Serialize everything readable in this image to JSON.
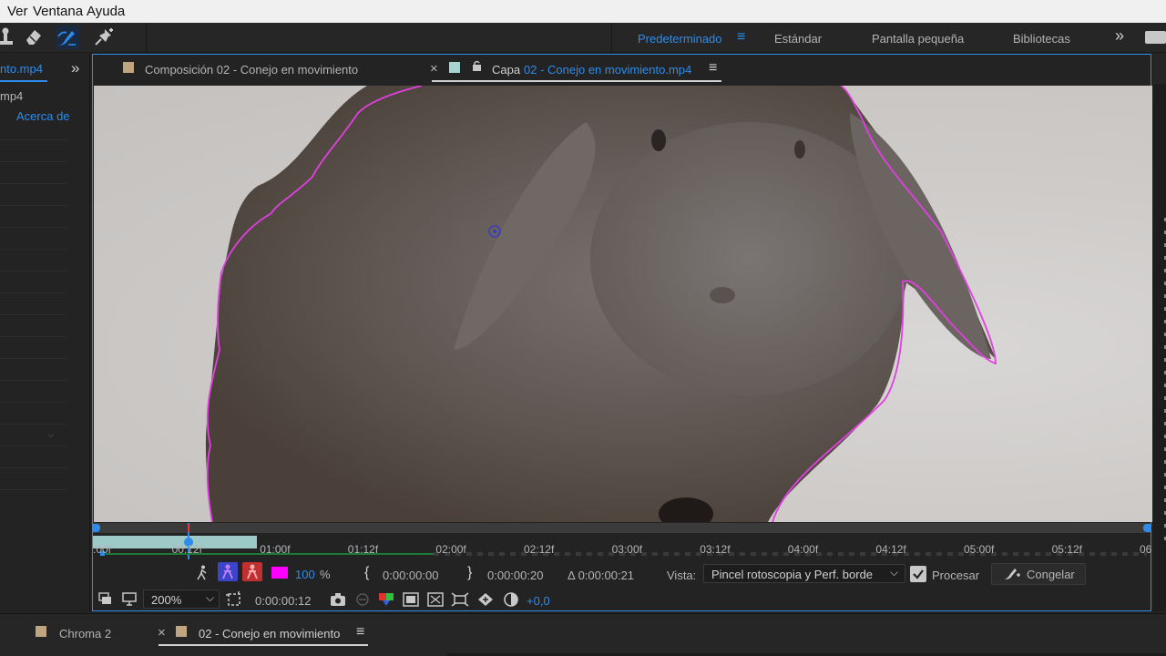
{
  "menubar": {
    "items": [
      "Ver",
      "Ventana",
      "Ayuda"
    ]
  },
  "toolbar": {
    "tools": [
      "stamp-icon",
      "eraser-icon",
      "roto-brush-icon",
      "pin-icon"
    ],
    "workspaces": [
      "Predeterminado",
      "Estándar",
      "Pantalla pequeña",
      "Bibliotecas"
    ],
    "active_workspace": "Predeterminado",
    "more_glyph": "»"
  },
  "left_panel": {
    "title": "nto.mp4",
    "subtitle": "mp4",
    "link": "Acerca de",
    "more_glyph": "»"
  },
  "viewer": {
    "tab_comp": "Composición 02 - Conejo en movimiento",
    "tab_layer_prefix": "Capa",
    "tab_layer_name": "02 - Conejo en movimiento.mp4",
    "close_glyph": "×",
    "menu_glyph": "≡"
  },
  "timeline": {
    "labels": [
      ":00f",
      "00:12f",
      "01:00f",
      "01:12f",
      "02:00f",
      "02:12f",
      "03:00f",
      "03:12f",
      "04:00f",
      "04:12f",
      "05:00f",
      "05:12f",
      "06"
    ],
    "work_area_fraction": [
      0.0,
      0.155
    ],
    "playhead_fraction": 0.09
  },
  "controls_row1": {
    "opacity_value": "100",
    "opacity_unit": "%",
    "in_time": "0:00:00:00",
    "out_time": "0:00:00:20",
    "duration": "Δ 0:00:00:21",
    "view_label": "Vista:",
    "view_value": "Pincel rotoscopia y Perf. borde",
    "process_label": "Procesar",
    "freeze_label": "Congelar",
    "brace_open": "{",
    "brace_close": "}"
  },
  "controls_row2": {
    "zoom": "200%",
    "current_time": "0:00:00:12",
    "exposure": "+0,0"
  },
  "bottom_tabs": {
    "tab1": "Chroma 2",
    "tab2": "02 - Conejo en movimiento",
    "close_glyph": "×",
    "menu_glyph": "≡"
  },
  "colors": {
    "accent": "#2d8ceb",
    "matte_outline": "#e040e0",
    "swatch_tan": "#c0a680",
    "swatch_teal": "#a8d4d0",
    "magenta": "#ff00ff"
  }
}
